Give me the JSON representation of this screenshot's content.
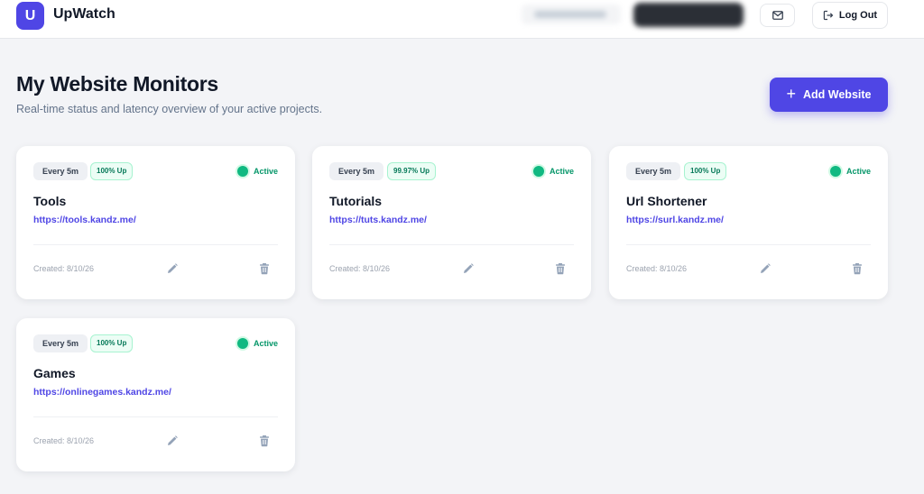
{
  "header": {
    "logo_letter": "U",
    "app_name": "UpWatch",
    "mail_icon": "mail-icon",
    "logout_label": "Log Out",
    "logout_icon": "logout-icon"
  },
  "page": {
    "title": "My Website Monitors",
    "subtitle": "Real-time status and latency overview of your active projects.",
    "add_button_label": "Add Website",
    "add_icon": "plus-icon"
  },
  "colors": {
    "accent": "#4f46e5",
    "active": "#10b981",
    "background": "#f3f4f7"
  },
  "monitors": [
    {
      "frequency": "Every 5m",
      "uptime": "100% Up",
      "status": "Active",
      "name": "Tools",
      "url": "https://tools.kandz.me/",
      "created": "Created: 8/10/26"
    },
    {
      "frequency": "Every 5m",
      "uptime": "99.97% Up",
      "status": "Active",
      "name": "Tutorials",
      "url": "https://tuts.kandz.me/",
      "created": "Created: 8/10/26"
    },
    {
      "frequency": "Every 5m",
      "uptime": "100% Up",
      "status": "Active",
      "name": "Url Shortener",
      "url": "https://surl.kandz.me/",
      "created": "Created: 8/10/26"
    },
    {
      "frequency": "Every 5m",
      "uptime": "100% Up",
      "status": "Active",
      "name": "Games",
      "url": "https://onlinegames.kandz.me/",
      "created": "Created: 8/10/26"
    }
  ]
}
